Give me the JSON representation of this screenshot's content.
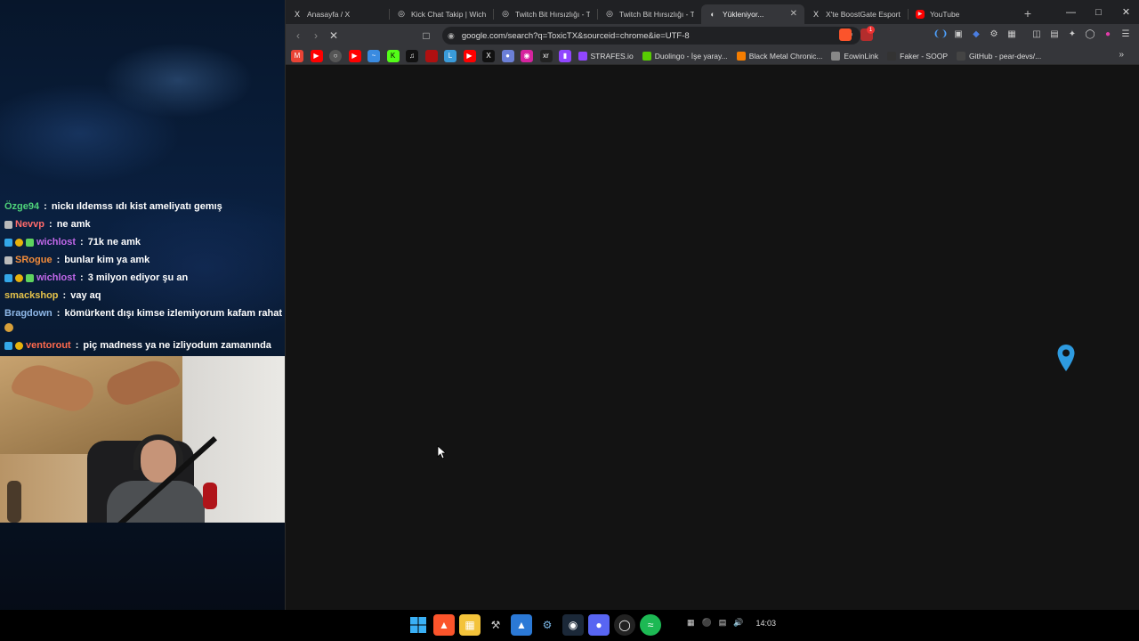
{
  "stream": {
    "chat": [
      {
        "user": "Özge94",
        "user_color": "#4fd37a",
        "badges": [],
        "message": "nickı ıldemss ıdı kist ameliyatı gemış"
      },
      {
        "user": "Nevvp",
        "user_color": "#ff6b6b",
        "badges": [
          "gray"
        ],
        "message": "ne amk"
      },
      {
        "user": "wichlost",
        "user_color": "#c067e8",
        "badges": [
          "blue",
          "gold",
          "grid"
        ],
        "message": "71k ne amk"
      },
      {
        "user": "SRogue",
        "user_color": "#f28b3a",
        "badges": [
          "gray"
        ],
        "message": "bunlar kim ya amk"
      },
      {
        "user": "wichlost",
        "user_color": "#c067e8",
        "badges": [
          "blue",
          "gold",
          "grid"
        ],
        "message": "3 milyon ediyor şu an"
      },
      {
        "user": "smackshop",
        "user_color": "#e6c34a",
        "badges": [],
        "message": "vay aq"
      },
      {
        "user": "Bragdown",
        "user_color": "#8fb8e8",
        "badges": [],
        "message": "kömürkent dışı kimse izlemiyorum kafam rahat"
      },
      {
        "user": "ventorout",
        "user_color": "#ff6a4d",
        "badges": [
          "blue",
          "gold"
        ],
        "message": "piç madness ya ne izliyodum zamanında"
      }
    ]
  },
  "browser": {
    "tabs": [
      {
        "title": "Anasayfa / X",
        "icon": "x-icon",
        "active": false
      },
      {
        "title": "Kick Chat Takip | Wich",
        "icon": "globe-icon",
        "active": false
      },
      {
        "title": "Twitch Bit Hırsızlığı - Ta",
        "icon": "globe-icon",
        "active": false
      },
      {
        "title": "Twitch Bit Hırsızlığı - Ta",
        "icon": "globe-icon",
        "active": false
      },
      {
        "title": "Yükleniyor...",
        "icon": "loading-icon",
        "active": true
      },
      {
        "title": "X'te BoostGate Esports",
        "icon": "x-icon",
        "active": false
      },
      {
        "title": "YouTube",
        "icon": "youtube-icon",
        "active": false
      }
    ],
    "url": "google.com/search?q=ToxicTX&sourceid=chrome&ie=UTF-8",
    "bookmarks": [
      {
        "label": "STRAFES.io",
        "color": "#9146ff"
      },
      {
        "label": "Duolingo - İşe yaray...",
        "color": "#58cc02"
      },
      {
        "label": "Black Metal Chronic...",
        "color": "#f57d00"
      },
      {
        "label": "EowinLink",
        "color": "#888888"
      },
      {
        "label": "Faker - SOOP",
        "color": "#333333"
      },
      {
        "label": "GitHub - pear-devs/...",
        "color": "#444444"
      }
    ],
    "brave_badge": "1"
  },
  "taskbar": {
    "clock": "14:03"
  },
  "colors": {
    "tabstrip": "#202124",
    "toolbar": "#35363a",
    "viewport": "#131313",
    "pin": "#2e9be0"
  }
}
